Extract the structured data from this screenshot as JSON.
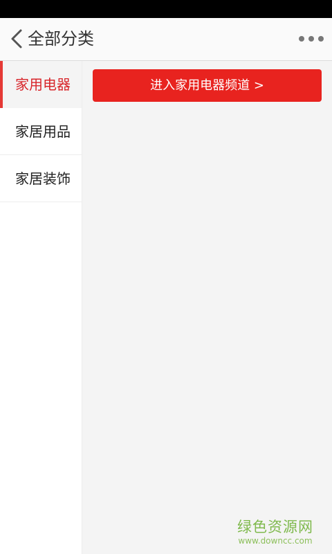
{
  "header": {
    "title": "全部分类",
    "back_icon": "chevron-left-icon",
    "more_icon": "more-horizontal-icon"
  },
  "sidebar": {
    "items": [
      {
        "label": "家用电器",
        "active": true
      },
      {
        "label": "家居用品",
        "active": false
      },
      {
        "label": "家居装饰",
        "active": false
      }
    ]
  },
  "content": {
    "enter_button_label": "进入家用电器频道 >"
  },
  "watermark": {
    "title": "绿色资源网",
    "url": "www.downcc.com"
  },
  "colors": {
    "accent": "#e8231f",
    "active_text": "#d8262b",
    "watermark": "#7fb94d"
  }
}
